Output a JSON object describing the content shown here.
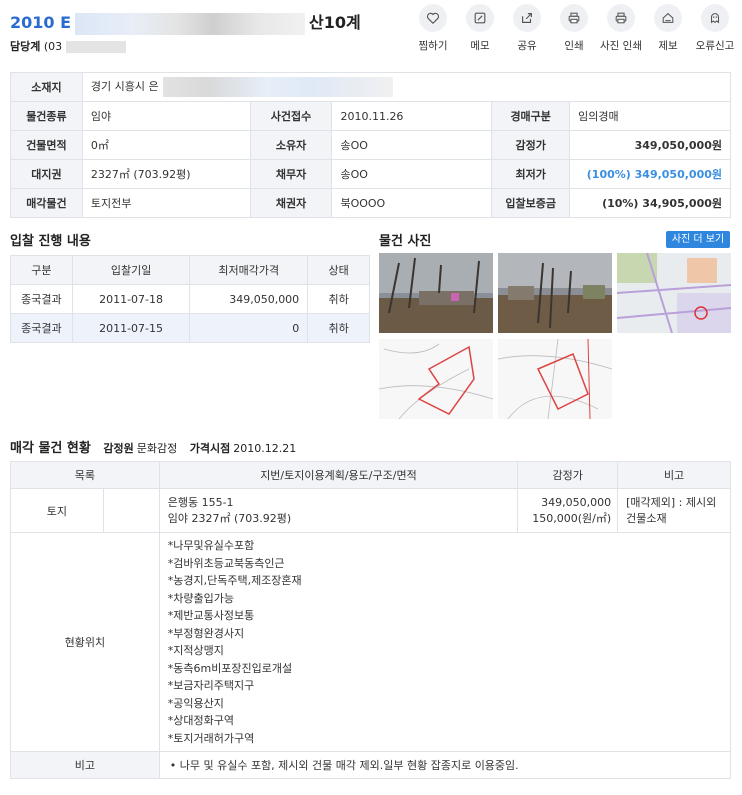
{
  "header": {
    "case_prefix": "2010 E",
    "case_suffix": "산10계",
    "contact_label": "담당계",
    "contact_value": "(03"
  },
  "actions": [
    {
      "label": "찜하기",
      "icon": "heart-icon"
    },
    {
      "label": "메모",
      "icon": "memo-icon"
    },
    {
      "label": "공유",
      "icon": "share-icon"
    },
    {
      "label": "인쇄",
      "icon": "print-icon"
    },
    {
      "label": "사진 인쇄",
      "icon": "photo-print-icon"
    },
    {
      "label": "제보",
      "icon": "report-icon"
    },
    {
      "label": "오류신고",
      "icon": "error-report-icon"
    }
  ],
  "info": {
    "location_label": "소재지",
    "location_value": "경기 시흥시 은",
    "rows": [
      {
        "k1": "물건종류",
        "v1": "임야",
        "k2": "사건접수",
        "v2": "2010.11.26",
        "k3": "경매구분",
        "v3": "임의경매"
      },
      {
        "k1": "건물면적",
        "v1": "0㎡",
        "k2": "소유자",
        "v2": "송OO",
        "k3": "감정가",
        "v3": "349,050,000원"
      },
      {
        "k1": "대지권",
        "v1": "2327㎡ (703.92평)",
        "k2": "채무자",
        "v2": "송OO",
        "k3": "최저가",
        "v3": "(100%) 349,050,000원"
      },
      {
        "k1": "매각물건",
        "v1": "토지전부",
        "k2": "채권자",
        "v2": "북OOOO",
        "k3": "입찰보증금",
        "v3": "(10%) 34,905,000원"
      }
    ]
  },
  "bids": {
    "title": "입찰 진행 내용",
    "headers": [
      "구분",
      "입찰기일",
      "최저매각가격",
      "상태"
    ],
    "rows": [
      {
        "type": "종국결과",
        "date": "2011-07-18",
        "price": "349,050,000",
        "status": "취하"
      },
      {
        "type": "종국결과",
        "date": "2011-07-15",
        "price": "0",
        "status": "취하"
      }
    ]
  },
  "photos": {
    "title": "물건 사진",
    "more_label": "사진 더 보기"
  },
  "status": {
    "title": "매각 물건 현황",
    "appraiser_label": "감정원",
    "appraiser_value": "문화감정",
    "price_date_label": "가격시점",
    "price_date_value": "2010.12.21",
    "headers": [
      "목록",
      "지번/토지이용계획/용도/구조/면적",
      "감정가",
      "비고"
    ],
    "land": {
      "type": "토지",
      "address": "은행동 155-1",
      "area": "임야 2327㎡ (703.92평)",
      "price": "349,050,000",
      "unit_price": "150,000(원/㎡)",
      "remark": "[매각제외] : 제시외건물소재"
    },
    "location_label": "현황위치",
    "location_items": [
      "*나무및유실수포함",
      "*검바위초등교북동측인근",
      "*농경지,단독주택,제조장혼재",
      "*차량출입가능",
      "*제반교통사정보통",
      "*부정형완경사지",
      "*지적상맹지",
      "*동측6m비포장진입로개설",
      "*보금자리주택지구",
      "*공익용산지",
      "*상대정화구역",
      "*토지거래허가구역"
    ],
    "remark_label": "비고",
    "remark_text": "나무 및 유실수 포함, 제시외 건물 매각 제외.일부 현황 잡종지로 이용중임."
  },
  "colors": {
    "accent": "#2a6bd1",
    "min_price": "#3b8fe0",
    "button": "#2f86de",
    "header_bg": "#f2f4f7"
  }
}
